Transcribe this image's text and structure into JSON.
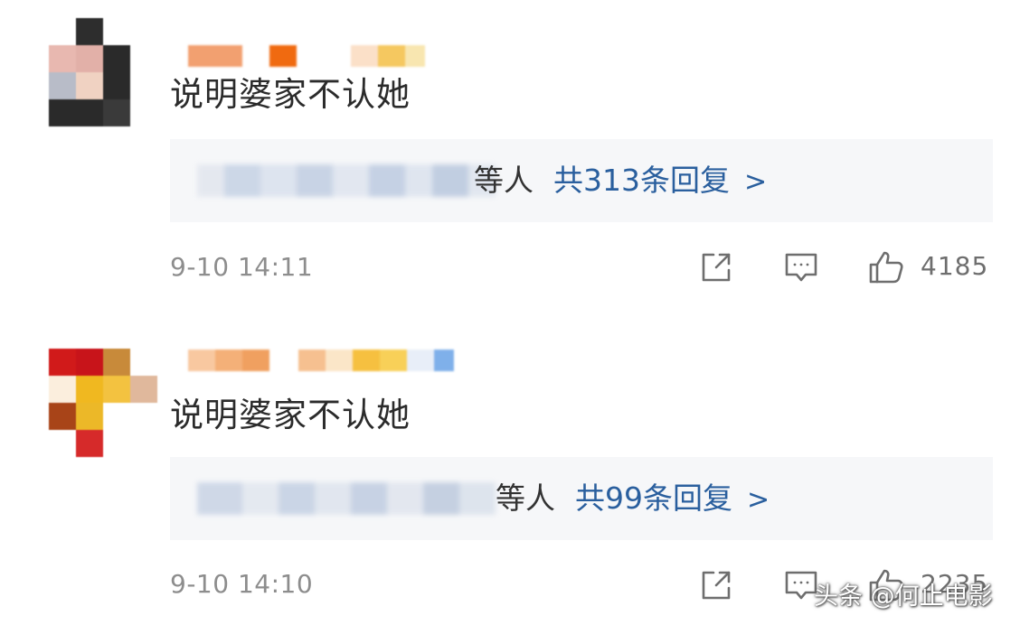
{
  "comments": [
    {
      "text": "说明婆家不认她",
      "reply_prefix": "等人",
      "reply_link": "共313条回复",
      "reply_chevron": ">",
      "timestamp": "9-10 14:11",
      "likes": "4185"
    },
    {
      "text": "说明婆家不认她",
      "reply_prefix": "等人",
      "reply_link": "共99条回复",
      "reply_chevron": ">",
      "timestamp": "9-10 14:10",
      "likes": "2235"
    }
  ],
  "icons": {
    "share": "share-icon",
    "comment": "comment-icon",
    "like": "thumbs-up-icon"
  },
  "colors": {
    "link": "#2a5f9e",
    "text": "#2b2b2b",
    "meta": "#8d8d8d",
    "reply_bg": "#f6f7f9"
  },
  "watermark": "头条 @何止电影"
}
